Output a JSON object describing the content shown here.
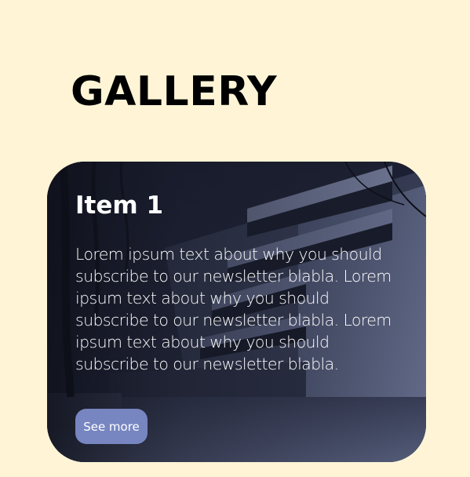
{
  "page": {
    "title": "GALLERY"
  },
  "gallery": {
    "items": [
      {
        "title": "Item 1",
        "description": "Lorem ipsum text about why you should subscribe to our newsletter blabla. Lorem ipsum text about why you should subscribe to our newsletter blabla. Lorem ipsum text about why you should subscribe to our newsletter blabla.",
        "button_label": "See more"
      }
    ]
  },
  "colors": {
    "page_background": "#fff5d6",
    "button_background": "#7786c1",
    "card_overlay": "#262b3e"
  }
}
